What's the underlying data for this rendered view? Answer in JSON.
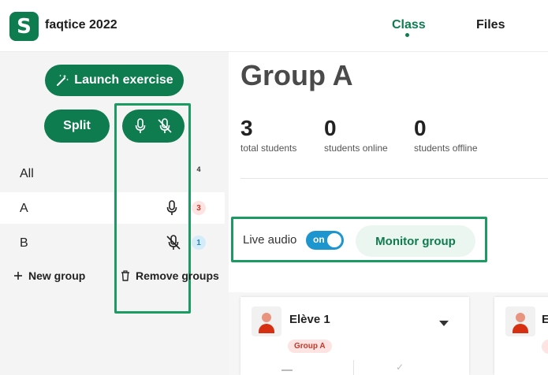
{
  "app": {
    "logo_letter": "S",
    "title": "faqtice 2022"
  },
  "nav": {
    "tabs": [
      {
        "label": "Class",
        "active": true
      },
      {
        "label": "Files",
        "active": false
      }
    ]
  },
  "sidebar": {
    "launch_label": "Launch exercise",
    "split_label": "Split",
    "groups": [
      {
        "label": "All",
        "count": "4",
        "mic": "none"
      },
      {
        "label": "A",
        "count": "3",
        "mic": "mic-icon"
      },
      {
        "label": "B",
        "count": "1",
        "mic": "mic-off-icon"
      }
    ],
    "new_group_label": "New group",
    "remove_groups_label": "Remove groups"
  },
  "main": {
    "group_title": "Group A",
    "stats": [
      {
        "value": "3",
        "label": "total students"
      },
      {
        "value": "0",
        "label": "students online"
      },
      {
        "value": "0",
        "label": "students offline"
      }
    ],
    "live_audio_label": "Live audio",
    "toggle_label": "on",
    "toggle_on": true,
    "monitor_label": "Monitor group",
    "students": [
      {
        "name": "Elève 1",
        "group_chip": "Group A"
      },
      {
        "name": "E",
        "group_chip": ""
      }
    ]
  },
  "colors": {
    "brand": "#0e7c4f",
    "highlight": "#1a9b62",
    "toggle": "#1d95cf"
  }
}
